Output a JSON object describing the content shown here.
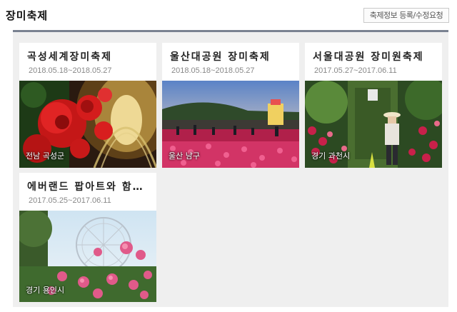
{
  "header": {
    "title": "장미축제",
    "request_button_label": "축제정보 등록/수정요청"
  },
  "festivals": [
    {
      "title": "곡성세계장미축제",
      "date": "2018.05.18~2018.05.27",
      "location": "전남 곡성군",
      "photo": "red roses under arched flower tunnel"
    },
    {
      "title": "울산대공원 장미축제",
      "date": "2018.05.18~2018.05.27",
      "location": "울산 남구",
      "photo": "rose field at dusk with crowd and lit tower"
    },
    {
      "title": "서울대공원 장미원축제",
      "date": "2017.05.27~2017.06.11",
      "location": "경기 과천시",
      "photo": "woman in hat among rose garden and trees"
    },
    {
      "title": "에버랜드 팝아트와 함께하는 장미축제",
      "date": "2017.05.25~2017.06.11",
      "location": "경기 용인시",
      "photo": "pink roses with ferris wheel in background"
    }
  ]
}
